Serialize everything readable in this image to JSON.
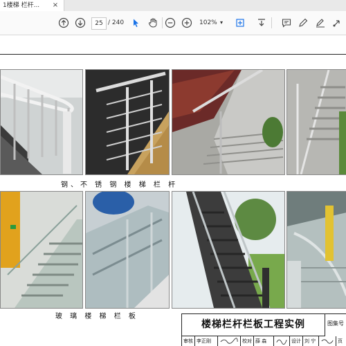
{
  "tab": {
    "title": "1楼梯 栏杆...",
    "close": "×"
  },
  "toolbar": {
    "page_current": "25",
    "page_total": "/ 240",
    "zoom": "102%"
  },
  "captions": {
    "steel": "钢、不 锈 钢 楼 梯 栏 杆",
    "glass": "玻 璃 楼 梯 栏 板"
  },
  "titleblock": {
    "title": "楼梯栏杆栏板工程实例",
    "atlas_label": "图集号",
    "reviewer_label": "审核",
    "reviewer_name": "李正刚",
    "checker_label": "校对",
    "checker_name": "薛 森",
    "designer_label": "设计",
    "designer_name": "刘 宁",
    "page_label": "页"
  },
  "colors": {
    "toolbar_bg": "#fafafa",
    "tabstrip_bg": "#e9e9e9",
    "accent_blue": "#1a73e8"
  }
}
